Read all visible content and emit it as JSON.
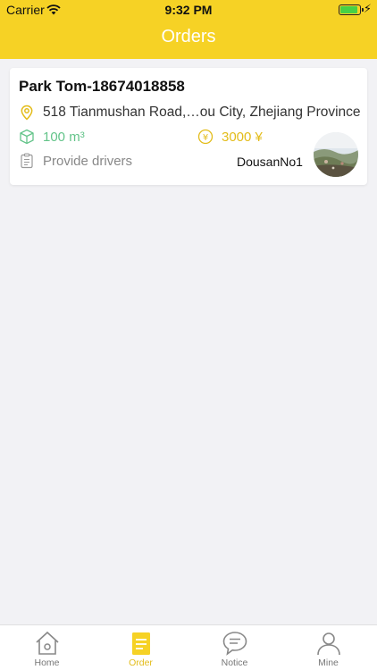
{
  "status_bar": {
    "carrier": "Carrier",
    "time": "9:32 PM"
  },
  "header": {
    "title": "Orders"
  },
  "orders": [
    {
      "contact": "Park Tom-18674018858",
      "address": "518 Tianmushan Road,…ou City, Zhejiang Province",
      "volume": "100 m³",
      "price": "3000 ¥",
      "service": "Provide drivers",
      "user_name": "DousanNo1"
    }
  ],
  "tabs": [
    {
      "label": "Home",
      "icon": "home-icon",
      "active": false
    },
    {
      "label": "Order",
      "icon": "order-icon",
      "active": true
    },
    {
      "label": "Notice",
      "icon": "chat-bubble-icon",
      "active": false
    },
    {
      "label": "Mine",
      "icon": "person-icon",
      "active": false
    }
  ],
  "colors": {
    "accent": "#f6d225",
    "volume_green": "#64c48a",
    "price_gold": "#e3bc1a",
    "background": "#f2f2f5"
  }
}
